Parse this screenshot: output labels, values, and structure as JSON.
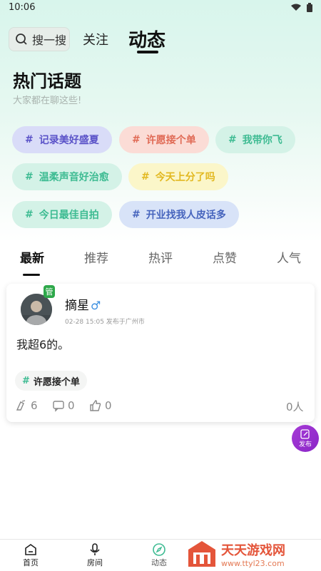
{
  "status": {
    "time": "10:06"
  },
  "nav": {
    "search_placeholder": "搜一搜",
    "follow": "关注",
    "feed": "动态"
  },
  "hot": {
    "title": "热门话题",
    "subtitle": "大家都在聊这些!",
    "topics": [
      {
        "label": "记录美好盛夏",
        "color": "#5a52c8"
      },
      {
        "label": "许愿接个单",
        "color": "#e06a55"
      },
      {
        "label": "我带你飞",
        "color": "#3dbb92"
      },
      {
        "label": "温柔声音好治愈",
        "color": "#3dbb92"
      },
      {
        "label": "今天上分了吗",
        "color": "#e2b820"
      },
      {
        "label": "今日最佳自拍",
        "color": "#3dbb92"
      },
      {
        "label": "开业找我人皮话多",
        "color": "#4664bd"
      }
    ]
  },
  "tabs": [
    "最新",
    "推荐",
    "热评",
    "点赞",
    "人气"
  ],
  "post": {
    "badge": "管",
    "user": "摘星",
    "gender_symbol": "♂",
    "meta": "02-28 15:05 发布于广州市",
    "body": "我超6的。",
    "tag": "许愿接个单",
    "likes": "6",
    "comments": "0",
    "thumbs": "0",
    "viewers": "0人"
  },
  "fab": {
    "label": "发布"
  },
  "bottom_nav": [
    "首页",
    "房间",
    "动态"
  ],
  "watermark": {
    "title": "天天游戏网",
    "url": "www.ttyl23.com"
  }
}
